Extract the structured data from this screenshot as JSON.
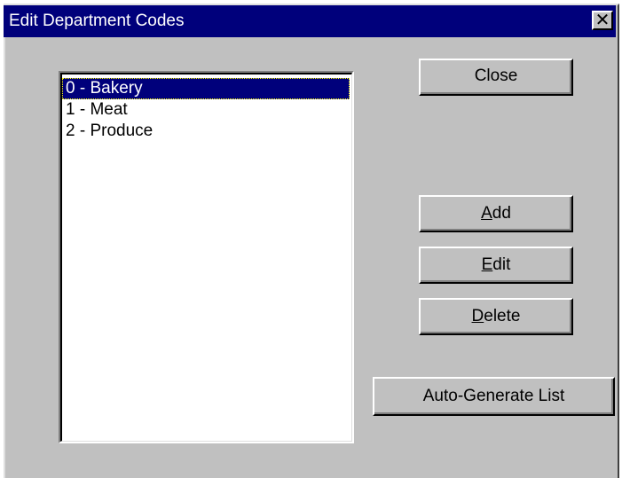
{
  "window": {
    "title": "Edit Department Codes",
    "close_glyph": "✕"
  },
  "list": {
    "items": [
      {
        "label": "0 - Bakery",
        "selected": true
      },
      {
        "label": "1 - Meat",
        "selected": false
      },
      {
        "label": "2 - Produce",
        "selected": false
      }
    ]
  },
  "buttons": {
    "close": "Close",
    "add": {
      "accel": "A",
      "rest": "dd"
    },
    "edit": {
      "accel": "E",
      "rest": "dit"
    },
    "delete": {
      "accel": "D",
      "rest": "elete"
    },
    "auto_generate": "Auto-Generate List"
  },
  "colors": {
    "titlebar": "#00007b",
    "face": "#c0c0c0",
    "selection": "#00007b"
  }
}
